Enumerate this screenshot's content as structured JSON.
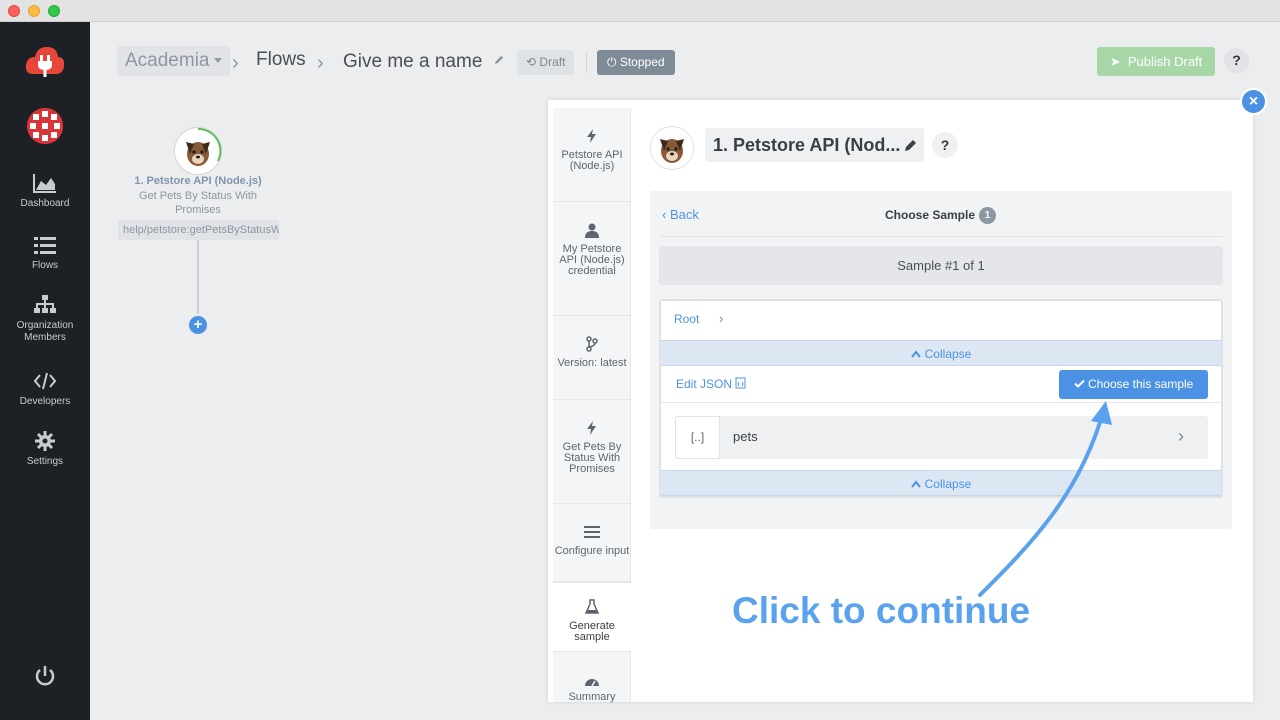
{
  "header": {
    "org_name": "Academia",
    "breadcrumb_flows": "Flows",
    "flow_name": "Give me a name",
    "draft_badge": "Draft",
    "stopped_badge": "Stopped",
    "publish_label": "Publish Draft",
    "help_label": "?",
    "colors": {
      "publish": "#a7d7a7",
      "stopped": "#7f8b97",
      "accent": "#4c92e4"
    }
  },
  "sidebar": {
    "items": [
      {
        "label": "Dashboard",
        "icon": "chart-area-icon"
      },
      {
        "label": "Flows",
        "icon": "list-icon"
      },
      {
        "label": "Organization Members",
        "icon": "sitemap-icon"
      },
      {
        "label": "Developers",
        "icon": "code-icon"
      },
      {
        "label": "Settings",
        "icon": "gear-icon"
      }
    ],
    "bottom_icon": "power-icon",
    "bg_color": "#1d2025"
  },
  "canvas": {
    "step_title": "1. Petstore API (Node.js)",
    "step_subtitle": "Get Pets By Status With Promises",
    "step_path": "help/petstore:getPetsByStatusW",
    "add_label": "+"
  },
  "panel": {
    "close_label": "×",
    "title": "1. Petstore API (Nod...",
    "help_label": "?",
    "wizard_steps": [
      {
        "label": "Petstore API (Node.js)",
        "icon": "bolt-icon"
      },
      {
        "label": "My Petstore API (Node.js) credential",
        "icon": "user-icon"
      },
      {
        "label": "Version: latest",
        "icon": "branch-icon"
      },
      {
        "label": "Get Pets By Status With Promises",
        "icon": "bolt-icon"
      },
      {
        "label": "Configure input",
        "icon": "bars-icon"
      },
      {
        "label": "Generate sample",
        "icon": "flask-icon"
      },
      {
        "label": "Summary",
        "icon": "dashboard-icon"
      }
    ],
    "back_label": "Back",
    "choose_header": "Choose Sample",
    "sample_count": "1",
    "sample_index": "Sample #1 of 1",
    "root_crumb": "Root",
    "collapse_label": "Collapse",
    "edit_json_label": "Edit JSON",
    "choose_button": "Choose this sample",
    "array_icon_label": "[..]",
    "pets_label": "pets"
  },
  "annotation": {
    "text": "Click to continue",
    "color": "#5aa2ee"
  }
}
